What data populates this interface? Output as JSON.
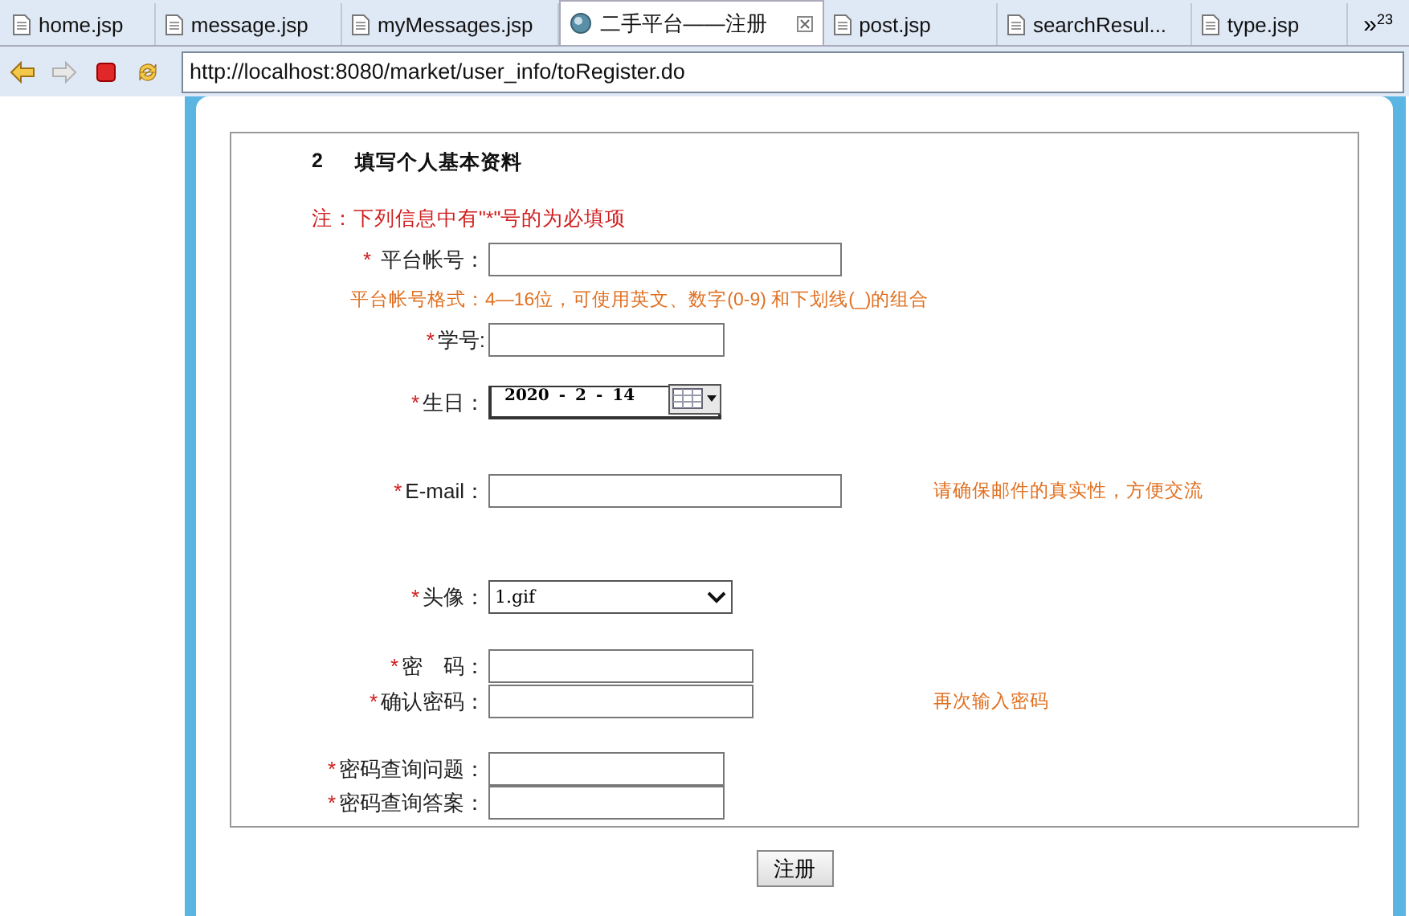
{
  "tabs": [
    {
      "label": "home.jsp",
      "kind": "file",
      "selected": false
    },
    {
      "label": "message.jsp",
      "kind": "file",
      "selected": false
    },
    {
      "label": "myMessages.jsp",
      "kind": "file",
      "selected": false
    },
    {
      "label": "二手平台——注册",
      "kind": "web",
      "selected": true
    },
    {
      "label": "post.jsp",
      "kind": "file",
      "selected": false
    },
    {
      "label": "searchResul...",
      "kind": "file",
      "selected": false
    },
    {
      "label": "type.jsp",
      "kind": "file",
      "selected": false
    }
  ],
  "tab_overflow": {
    "symbol": "»",
    "count": "23"
  },
  "toolbar": {
    "buttons": [
      {
        "kind": "back",
        "disabled": false
      },
      {
        "kind": "forward",
        "disabled": true
      },
      {
        "kind": "stop",
        "disabled": false
      },
      {
        "kind": "refresh",
        "disabled": false
      }
    ],
    "address": "http://localhost:8080/market/user_info/toRegister.do"
  },
  "form": {
    "step": "2",
    "title": "填写个人基本资料",
    "note": "注：下列信息中有\"*\"号的为必填项",
    "fields": [
      {
        "kind": "text",
        "mark": "*",
        "label": "平台帐号：",
        "hint_below": "平台帐号格式：4—16位，可使用英文、数字(0-9) 和下划线(_)的组合"
      },
      {
        "kind": "text",
        "mark": "*",
        "label": "学号:"
      },
      {
        "kind": "date",
        "mark": "*",
        "label": "生日：",
        "parts": [
          "2020",
          "-",
          "2",
          "-",
          "14"
        ]
      },
      {
        "kind": "text",
        "mark": "*",
        "label": "E-mail：",
        "hint_side": "请确保邮件的真实性，方便交流"
      },
      {
        "kind": "select",
        "mark": "*",
        "label": "头像：",
        "value": "1.gif"
      },
      {
        "kind": "password",
        "mark": "*",
        "label": "密　码："
      },
      {
        "kind": "password",
        "mark": "*",
        "label": "确认密码：",
        "hint_side": "再次输入密码"
      },
      {
        "kind": "text",
        "mark": "*",
        "label": "密码查询问题："
      },
      {
        "kind": "text",
        "mark": "*",
        "label": "密码查询答案："
      }
    ],
    "submit": "注册"
  }
}
